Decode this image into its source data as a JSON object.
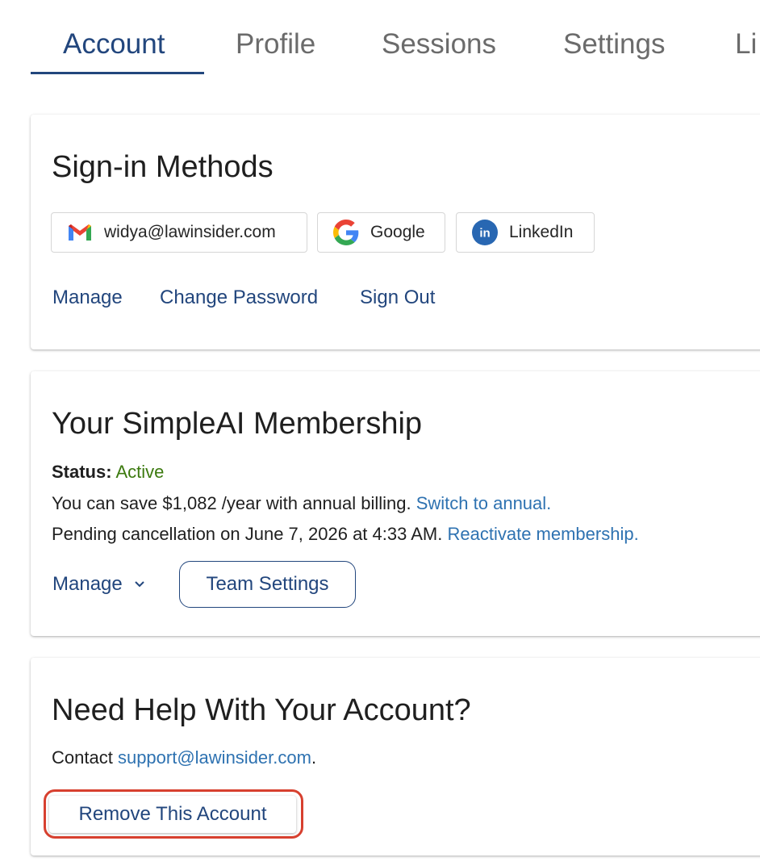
{
  "tabs": [
    {
      "label": "Account",
      "active": true
    },
    {
      "label": "Profile",
      "active": false
    },
    {
      "label": "Sessions",
      "active": false
    },
    {
      "label": "Settings",
      "active": false
    },
    {
      "label": "Li",
      "active": false
    }
  ],
  "sign_in": {
    "title": "Sign-in Methods",
    "methods": [
      {
        "label": "widya@lawinsider.com",
        "icon": "gmail-icon"
      },
      {
        "label": "Google",
        "icon": "google-icon"
      },
      {
        "label": "LinkedIn",
        "icon": "linkedin-icon"
      }
    ],
    "links": {
      "manage": "Manage",
      "change_password": "Change Password",
      "sign_out": "Sign Out"
    }
  },
  "membership": {
    "title": "Your SimpleAI Membership",
    "status_label": "Status:",
    "status_value": "Active",
    "savings_text": "You can save $1,082 /year with annual billing.",
    "switch_link": "Switch to annual.",
    "pending_text": "Pending cancellation on June 7, 2026 at 4:33 AM.",
    "reactivate_link": "Reactivate membership.",
    "manage_label": "Manage",
    "team_settings_label": "Team Settings"
  },
  "help": {
    "title": "Need Help With Your Account?",
    "contact_prefix": "Contact",
    "support_email": "support@lawinsider.com",
    "contact_suffix": ".",
    "remove_label": "Remove This Account"
  },
  "colors": {
    "primary": "#22467d",
    "link": "#2e72b1",
    "active_status": "#3c7a0f",
    "highlight": "#d7402f",
    "tab_inactive": "#6b6b6b"
  }
}
